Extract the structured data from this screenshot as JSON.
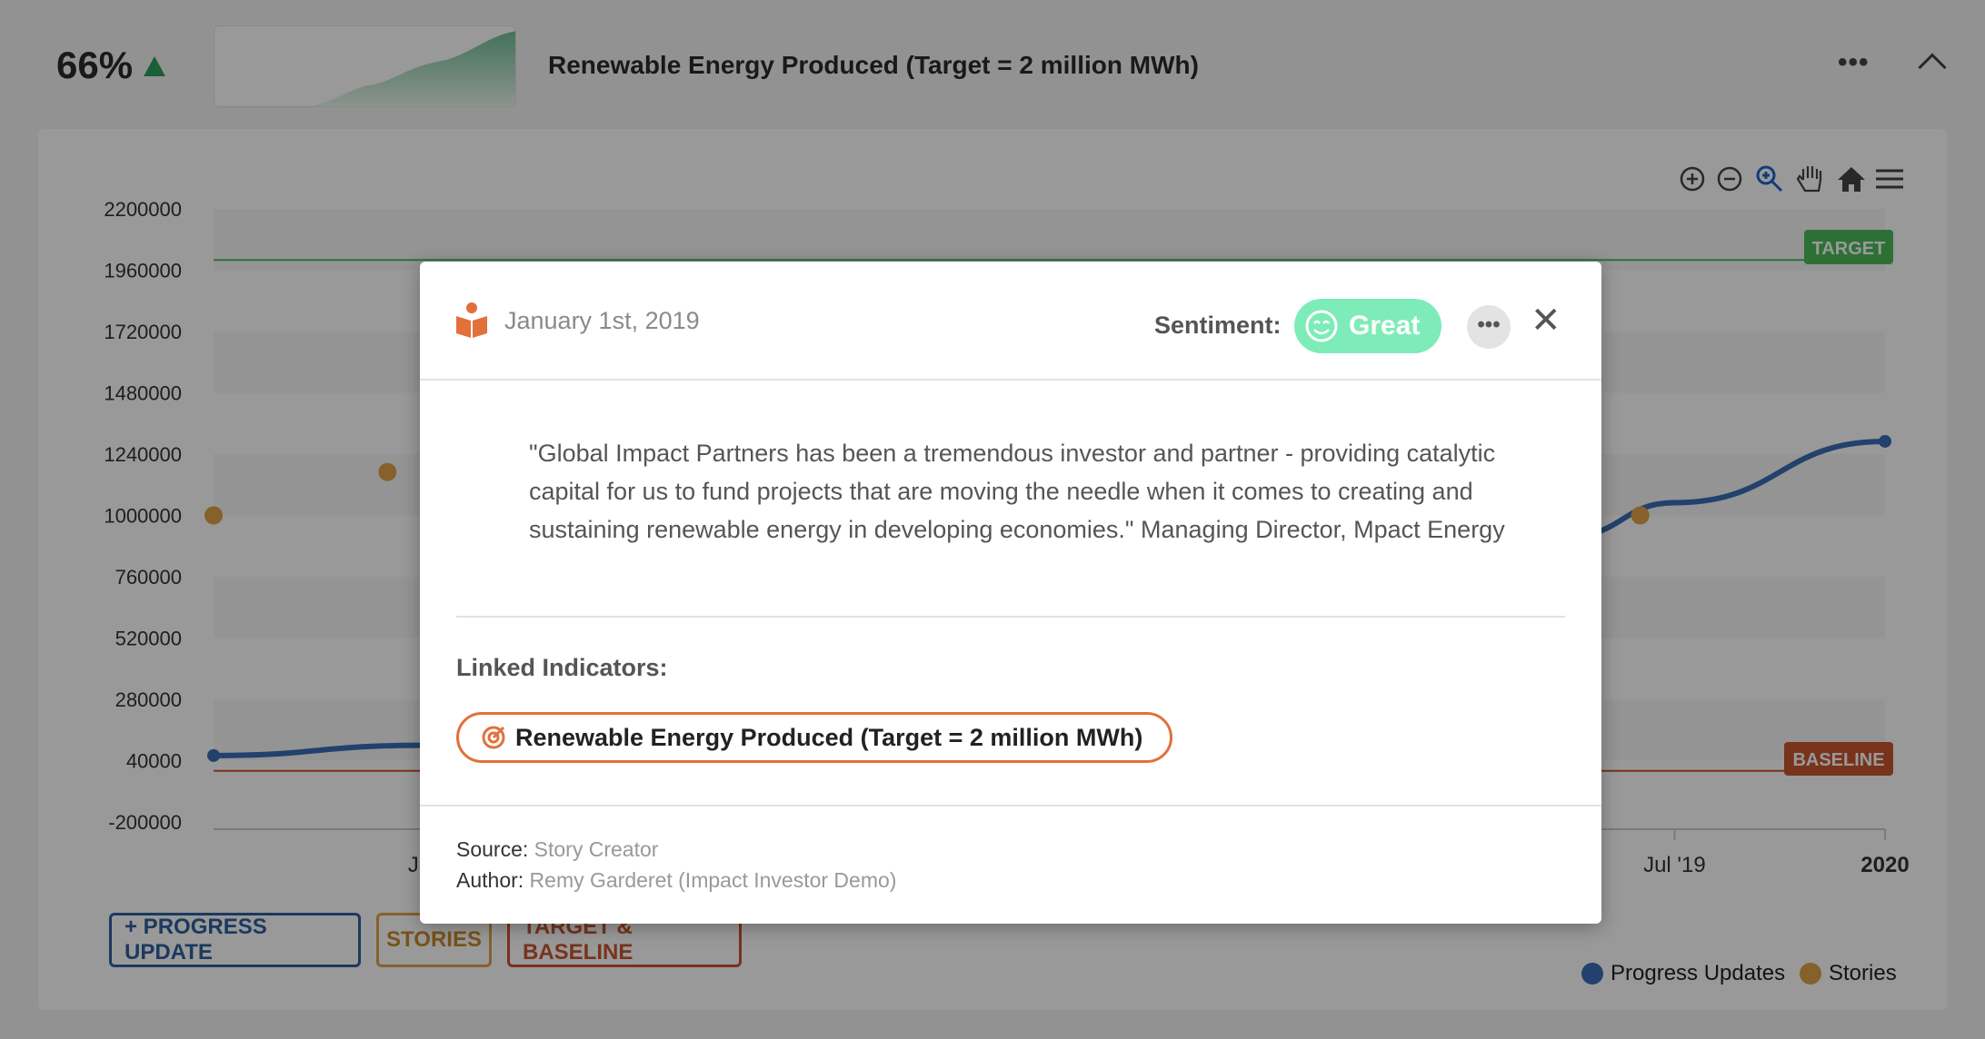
{
  "header": {
    "percent": "66%",
    "trend": "up",
    "title": "Renewable Energy Produced (Target = 2 million MWh)",
    "more_label": "•••"
  },
  "toolbar": {
    "icons": [
      "zoom-in-icon",
      "zoom-out-icon",
      "selection-zoom-icon",
      "pan-icon",
      "reset-home-icon",
      "menu-icon"
    ]
  },
  "colors": {
    "progress": "#3a6db5",
    "stories": "#e0a24a",
    "target": "#4cbb5a",
    "baseline": "#c9552e",
    "great": "#7eecb8",
    "accent_orange": "#e2703b"
  },
  "chart_data": {
    "type": "line",
    "y_ticks": [
      "2200000",
      "1960000",
      "1720000",
      "1480000",
      "1240000",
      "1000000",
      "760000",
      "520000",
      "280000",
      "40000",
      "-200000"
    ],
    "ylim": [
      -200000,
      2200000
    ],
    "x_ticks": [
      {
        "label": "Jul",
        "x": "2016-07-01",
        "bold": false
      },
      {
        "label": "Jul '19",
        "x": "2019-07-01",
        "bold": false
      },
      {
        "label": "2020",
        "x": "2020-01-01",
        "bold": true
      }
    ],
    "xlim": [
      "2016-01-01",
      "2020-01-01"
    ],
    "target": {
      "label": "TARGET",
      "value": 2000000
    },
    "baseline": {
      "label": "BASELINE",
      "value": 0
    },
    "series": [
      {
        "name": "Progress Updates",
        "kind": "line",
        "points": [
          [
            "2016-01-01",
            60000
          ],
          [
            "2016-07-01",
            100000
          ],
          [
            "2017-06-01",
            300000
          ],
          [
            "2018-06-01",
            600000
          ],
          [
            "2019-04-01",
            920000
          ],
          [
            "2019-07-01",
            1050000
          ],
          [
            "2020-01-01",
            1290000
          ]
        ]
      },
      {
        "name": "Stories",
        "kind": "scatter",
        "points": [
          [
            "2016-01-01",
            1000000
          ],
          [
            "2016-06-01",
            1170000
          ],
          [
            "2019-06-01",
            1000000
          ]
        ]
      }
    ]
  },
  "buttons": {
    "progress": "+ PROGRESS UPDATE",
    "stories": "STORIES",
    "target_baseline": "TARGET & BASELINE"
  },
  "legend": {
    "progress": "Progress Updates",
    "stories": "Stories"
  },
  "modal": {
    "date": "January 1st, 2019",
    "sentiment_label": "Sentiment:",
    "sentiment_value": "Great",
    "more": "•••",
    "close": "✕",
    "quote": "\"Global Impact Partners has been a tremendous investor and partner - providing catalytic capital for us to fund projects that are moving the needle when it comes to creating and sustaining renewable energy in developing economies.\" Managing Director, Mpact Energy",
    "linked_label": "Linked Indicators:",
    "linked_indicator": "Renewable Energy Produced (Target = 2 million MWh)",
    "source_label": "Source:",
    "source": "Story Creator",
    "author_label": "Author:",
    "author": "Remy Garderet (Impact Investor Demo)"
  }
}
